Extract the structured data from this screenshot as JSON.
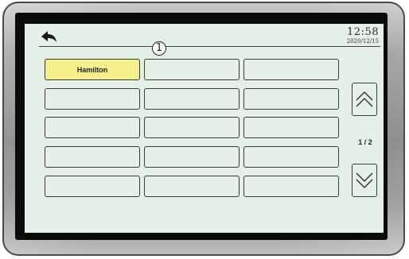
{
  "header": {
    "time": "12:58",
    "date": "2020/12/15"
  },
  "grid": {
    "cells": [
      [
        "Hamilton",
        "",
        ""
      ],
      [
        "",
        "",
        ""
      ],
      [
        "",
        "",
        ""
      ],
      [
        "",
        "",
        ""
      ],
      [
        "",
        "",
        ""
      ]
    ],
    "selected": [
      0,
      0
    ]
  },
  "marker": "1",
  "pagination": {
    "indicator": "1 / 2"
  },
  "icons": {
    "back": "back-arrow-icon",
    "up": "double-chevron-up-icon",
    "down": "double-chevron-down-icon"
  },
  "colors": {
    "screen_background": "#e3f1e6",
    "selected_button": "#f5f08c",
    "bezel": "#8a8a8a"
  }
}
